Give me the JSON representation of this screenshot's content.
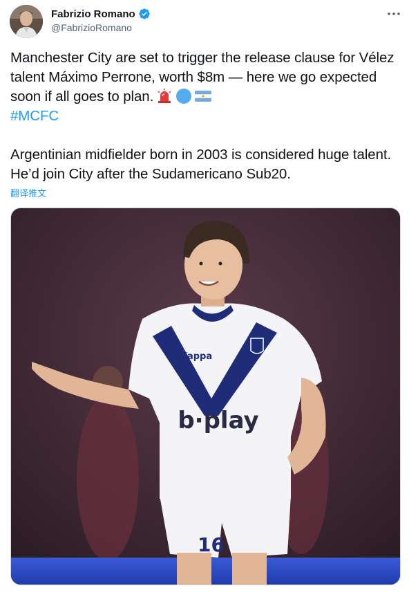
{
  "author": {
    "display_name": "Fabrizio Romano",
    "handle": "@FabrizioRomano",
    "verified": true
  },
  "tweet": {
    "text_line1": "Manchester City are set to trigger the release clause for Vélez talent Máximo Perrone, worth $8m — here we go expected soon if all goes to plan.",
    "hashtag": "#MCFC",
    "text_para2": "Argentinian midfielder born in 2003 is considered huge talent. He’d join City after the Sudamericano Sub20.",
    "emojis": [
      "police-light-icon",
      "blue-circle-icon",
      "argentina-flag-icon"
    ],
    "translate_label": "翻译推文"
  },
  "media": {
    "shirt_sponsor": "b·play",
    "shirt_number": "16",
    "shirt_maker": "Kappa"
  },
  "colors": {
    "link": "#1d9bf0",
    "text": "#0f1419",
    "secondary": "#536471"
  }
}
